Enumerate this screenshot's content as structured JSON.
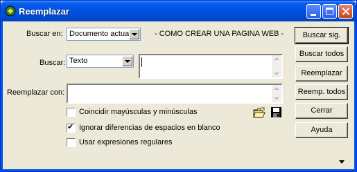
{
  "window": {
    "title": "Reemplazar"
  },
  "search_in": {
    "label": "Buscar en:",
    "value": "Documento actual",
    "document_title": "- COMO CREAR UNA PAGINA WEB -"
  },
  "search": {
    "label": "Buscar:",
    "type_value": "Texto",
    "value": ""
  },
  "replace": {
    "label": "Reemplazar con:",
    "value": ""
  },
  "options": {
    "match_case": {
      "label": "Coincidir mayúsculas y minúsculas",
      "checked": false
    },
    "ignore_whitespace": {
      "label": "Ignorar diferencias de espacios en blanco",
      "checked": true
    },
    "regex": {
      "label": "Usar expresiones regulares",
      "checked": false
    }
  },
  "buttons": {
    "find_next": "Buscar sig.",
    "find_all": "Buscar todos",
    "replace": "Reemplazar",
    "replace_all": "Reemp. todos",
    "close": "Cerrar",
    "help": "Ayuda"
  },
  "colors": {
    "titlebar": "#0054e3",
    "face": "#ece9d8"
  }
}
